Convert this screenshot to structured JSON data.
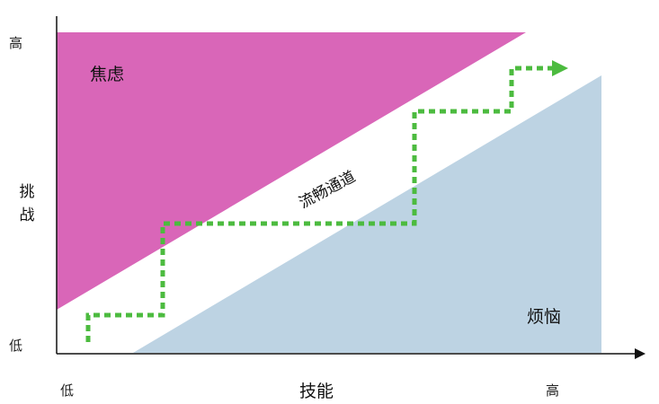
{
  "axes": {
    "y_title": [
      "挑",
      "战"
    ],
    "y_high": "高",
    "y_low": "低",
    "x_title": "技能",
    "x_low": "低",
    "x_high": "高"
  },
  "regions": {
    "anxiety": "焦虑",
    "flow_channel": "流畅通道",
    "boredom": "烦恼"
  },
  "colors": {
    "anxiety": "#d966b8",
    "boredom": "#bdd3e3",
    "path": "#4cbb3f",
    "axis": "#111111"
  },
  "icons": {
    "path_end": "arrow-right-icon"
  }
}
